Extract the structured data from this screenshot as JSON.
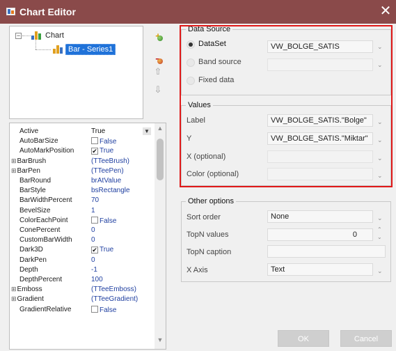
{
  "window": {
    "title": "Chart Editor",
    "close_glyph": "✕"
  },
  "tree": {
    "root_label": "Chart",
    "child_label": "Bar - Series1",
    "expander_glyph": "−",
    "icons": [
      "chart-icon",
      "bar-series-icon"
    ]
  },
  "tools": {
    "up_glyph": "⇧",
    "down_glyph": "⇩",
    "add_glyph": "+",
    "delete_glyph": "−"
  },
  "properties": [
    {
      "name": "Active",
      "value": "True",
      "kind": "dropdown"
    },
    {
      "name": "AutoBarSize",
      "value": "False",
      "kind": "checkbox",
      "checked": false
    },
    {
      "name": "AutoMarkPosition",
      "value": "True",
      "kind": "checkbox",
      "checked": true
    },
    {
      "name": "BarBrush",
      "value": "(TTeeBrush)",
      "kind": "expandable"
    },
    {
      "name": "BarPen",
      "value": "(TTeePen)",
      "kind": "expandable"
    },
    {
      "name": "BarRound",
      "value": "brAtValue",
      "kind": "text"
    },
    {
      "name": "BarStyle",
      "value": "bsRectangle",
      "kind": "text"
    },
    {
      "name": "BarWidthPercent",
      "value": "70",
      "kind": "text"
    },
    {
      "name": "BevelSize",
      "value": "1",
      "kind": "text"
    },
    {
      "name": "ColorEachPoint",
      "value": "False",
      "kind": "checkbox",
      "checked": false
    },
    {
      "name": "ConePercent",
      "value": "0",
      "kind": "text"
    },
    {
      "name": "CustomBarWidth",
      "value": "0",
      "kind": "text"
    },
    {
      "name": "Dark3D",
      "value": "True",
      "kind": "checkbox",
      "checked": true
    },
    {
      "name": "DarkPen",
      "value": "0",
      "kind": "text"
    },
    {
      "name": "Depth",
      "value": "-1",
      "kind": "text"
    },
    {
      "name": "DepthPercent",
      "value": "100",
      "kind": "text"
    },
    {
      "name": "Emboss",
      "value": "(TTeeEmboss)",
      "kind": "expandable"
    },
    {
      "name": "Gradient",
      "value": "(TTeeGradient)",
      "kind": "expandable"
    },
    {
      "name": "GradientRelative",
      "value": "False",
      "kind": "checkbox",
      "checked": false
    }
  ],
  "check_glyph": "✔",
  "dropdown_glyph": "▼",
  "chevron_glyph": "⌄",
  "data_source": {
    "title": "Data Source",
    "selected": "DataSet",
    "options": [
      {
        "label": "DataSet",
        "value": "VW_BOLGE_SATIS",
        "checked": true
      },
      {
        "label": "Band source",
        "value": "",
        "checked": false
      },
      {
        "label": "Fixed data",
        "value": null,
        "checked": false
      }
    ]
  },
  "values": {
    "title": "Values",
    "fields": [
      {
        "label": "Label",
        "value": "VW_BOLGE_SATIS.\"Bolge\""
      },
      {
        "label": "Y",
        "value": "VW_BOLGE_SATIS.\"Miktar\""
      },
      {
        "label": "X (optional)",
        "value": ""
      },
      {
        "label": "Color (optional)",
        "value": ""
      }
    ]
  },
  "other_options": {
    "title": "Other options",
    "sort_order": {
      "label": "Sort order",
      "value": "None"
    },
    "topn_values": {
      "label": "TopN values",
      "value": "0"
    },
    "topn_caption": {
      "label": "TopN caption",
      "value": ""
    },
    "x_axis": {
      "label": "X Axis",
      "value": "Text"
    }
  },
  "buttons": {
    "ok": "OK",
    "cancel": "Cancel"
  }
}
